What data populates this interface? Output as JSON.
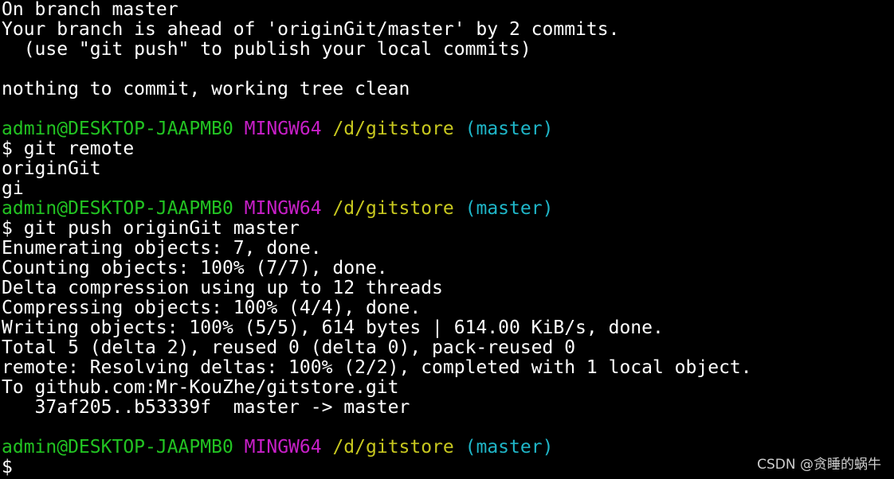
{
  "colors": {
    "background": "#000000",
    "text": "#ffffff",
    "user_host": "#22c322",
    "mingw": "#c81fc8",
    "path": "#c8c81f",
    "branch": "#1fb6c8"
  },
  "lines": [
    {
      "type": "text",
      "text": "On branch master"
    },
    {
      "type": "text",
      "text": "Your branch is ahead of 'originGit/master' by 2 commits."
    },
    {
      "type": "text",
      "text": "  (use \"git push\" to publish your local commits)"
    },
    {
      "type": "blank",
      "text": ""
    },
    {
      "type": "text",
      "text": "nothing to commit, working tree clean"
    },
    {
      "type": "blank",
      "text": ""
    },
    {
      "type": "prompt",
      "user": "admin@DESKTOP-JAAPMB0",
      "host": "MINGW64",
      "path": "/d/gitstore",
      "branch": "(master)"
    },
    {
      "type": "command",
      "text": "$ git remote"
    },
    {
      "type": "text",
      "text": "originGit"
    },
    {
      "type": "text",
      "text": "gi"
    },
    {
      "type": "prompt",
      "user": "admin@DESKTOP-JAAPMB0",
      "host": "MINGW64",
      "path": "/d/gitstore",
      "branch": "(master)"
    },
    {
      "type": "command",
      "text": "$ git push originGit master"
    },
    {
      "type": "text",
      "text": "Enumerating objects: 7, done."
    },
    {
      "type": "text",
      "text": "Counting objects: 100% (7/7), done."
    },
    {
      "type": "text",
      "text": "Delta compression using up to 12 threads"
    },
    {
      "type": "text",
      "text": "Compressing objects: 100% (4/4), done."
    },
    {
      "type": "text",
      "text": "Writing objects: 100% (5/5), 614 bytes | 614.00 KiB/s, done."
    },
    {
      "type": "text",
      "text": "Total 5 (delta 2), reused 0 (delta 0), pack-reused 0"
    },
    {
      "type": "text",
      "text": "remote: Resolving deltas: 100% (2/2), completed with 1 local object."
    },
    {
      "type": "text",
      "text": "To github.com:Mr-KouZhe/gitstore.git"
    },
    {
      "type": "text",
      "text": "   37af205..b53339f  master -> master"
    },
    {
      "type": "blank",
      "text": ""
    },
    {
      "type": "prompt",
      "user": "admin@DESKTOP-JAAPMB0",
      "host": "MINGW64",
      "path": "/d/gitstore",
      "branch": "(master)"
    },
    {
      "type": "command",
      "text": "$"
    }
  ],
  "watermark": "CSDN @贪睡的蜗牛"
}
